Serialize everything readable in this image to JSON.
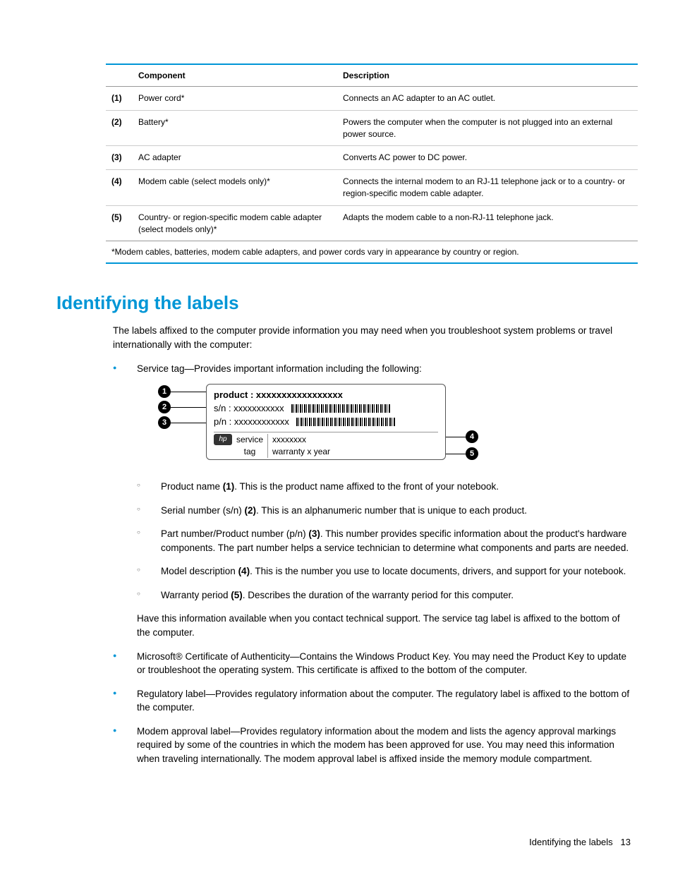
{
  "table": {
    "headers": {
      "component": "Component",
      "description": "Description"
    },
    "rows": [
      {
        "num": "(1)",
        "comp": "Power cord*",
        "desc": "Connects an AC adapter to an AC outlet."
      },
      {
        "num": "(2)",
        "comp": "Battery*",
        "desc": "Powers the computer when the computer is not plugged into an external power source."
      },
      {
        "num": "(3)",
        "comp": "AC adapter",
        "desc": "Converts AC power to DC power."
      },
      {
        "num": "(4)",
        "comp": "Modem cable (select models only)*",
        "desc": "Connects the internal modem to an RJ-11 telephone jack or to a country- or region-specific modem cable adapter."
      },
      {
        "num": "(5)",
        "comp": "Country- or region-specific modem cable adapter (select models only)*",
        "desc": "Adapts the modem cable to a non-RJ-11 telephone jack."
      }
    ],
    "footnote": "*Modem cables, batteries, modem cable adapters, and power cords vary in appearance by country or region."
  },
  "heading": "Identifying the labels",
  "intro": "The labels affixed to the computer provide information you may need when you troubleshoot system problems or travel internationally with the computer:",
  "bullet_service_tag": "Service tag—Provides important information including the following:",
  "diagram": {
    "product": "product : xxxxxxxxxxxxxxxxx",
    "sn": "s/n : xxxxxxxxxxx",
    "pn": "p/n : xxxxxxxxxxxx",
    "hp": "hp",
    "service": "service",
    "tag": "tag",
    "model": "xxxxxxxx",
    "warranty": "warranty   x year",
    "c1": "1",
    "c2": "2",
    "c3": "3",
    "c4": "4",
    "c5": "5"
  },
  "sub_items": [
    {
      "pre": "Product name ",
      "bold": "(1)",
      "post": ". This is the product name affixed to the front of your notebook."
    },
    {
      "pre": "Serial number (s/n) ",
      "bold": "(2)",
      "post": ". This is an alphanumeric number that is unique to each product."
    },
    {
      "pre": "Part number/Product number (p/n) ",
      "bold": "(3)",
      "post": ". This number provides specific information about the product's hardware components. The part number helps a service technician to determine what components and parts are needed."
    },
    {
      "pre": "Model description ",
      "bold": "(4)",
      "post": ". This is the number you use to locate documents, drivers, and support for your notebook."
    },
    {
      "pre": "Warranty period ",
      "bold": "(5)",
      "post": ". Describes the duration of the warranty period for this computer."
    }
  ],
  "have_info": "Have this information available when you contact technical support. The service tag label is affixed to the bottom of the computer.",
  "other_bullets": [
    "Microsoft® Certificate of Authenticity—Contains the Windows Product Key. You may need the Product Key to update or troubleshoot the operating system. This certificate is affixed to the bottom of the computer.",
    "Regulatory label—Provides regulatory information about the computer. The regulatory label is affixed to the bottom of the computer.",
    "Modem approval label—Provides regulatory information about the modem and lists the agency approval markings required by some of the countries in which the modem has been approved for use. You may need this information when traveling internationally. The modem approval label is affixed inside the memory module compartment."
  ],
  "footer": {
    "title": "Identifying the labels",
    "page": "13"
  }
}
